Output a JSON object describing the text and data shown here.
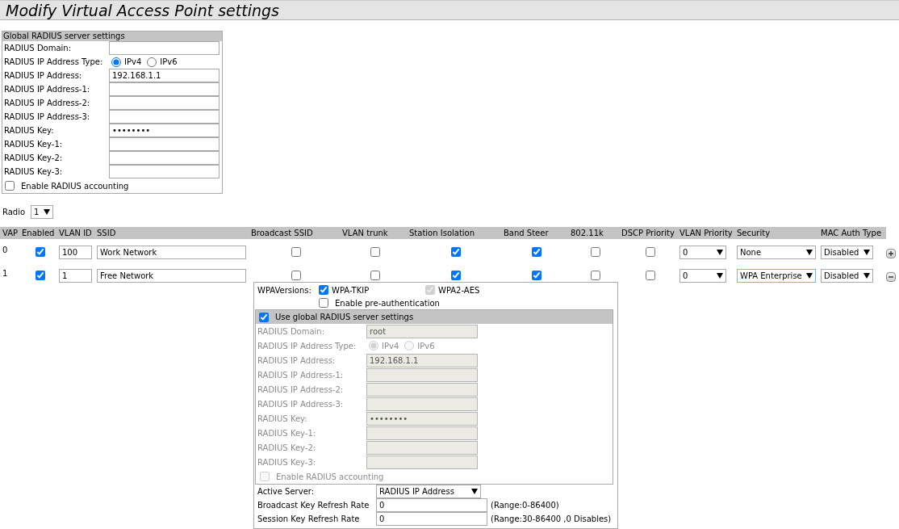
{
  "title": "Modify Virtual Access Point settings",
  "global_radius": {
    "header": "Global RADIUS server settings",
    "fields": [
      {
        "kind": "text",
        "label": "RADIUS Domain:"
      },
      {
        "kind": "radio",
        "label": "RADIUS IP Address Type:",
        "options": [
          {
            "label": "IPv4",
            "selected": true
          },
          {
            "label": "IPv6",
            "selected": false
          }
        ]
      },
      {
        "kind": "text",
        "label": "RADIUS IP Address:",
        "value": "192.168.1.1"
      },
      {
        "kind": "text",
        "label": "RADIUS IP Address-1:"
      },
      {
        "kind": "text",
        "label": "RADIUS IP Address-2:"
      },
      {
        "kind": "text",
        "label": "RADIUS IP Address-3:"
      },
      {
        "kind": "text",
        "label": "RADIUS Key:",
        "value": "••••••••"
      },
      {
        "kind": "text",
        "label": "RADIUS Key-1:"
      },
      {
        "kind": "text",
        "label": "RADIUS Key-2:"
      },
      {
        "kind": "text",
        "label": "RADIUS Key-3:"
      }
    ],
    "accounting": {
      "label": "Enable RADIUS accounting",
      "checked": false
    }
  },
  "radio": {
    "label": "Radio",
    "value": "1"
  },
  "vap_table": {
    "columns": [
      "VAP",
      "Enabled",
      "VLAN ID",
      "SSID",
      "Broadcast SSID",
      "VLAN trunk",
      "Station Isolation",
      "Band Steer",
      "802.11k",
      "DSCP Priority",
      "VLAN Priority",
      "Security",
      "MAC Auth Type"
    ],
    "rows": [
      {
        "vap": "0",
        "enabled": true,
        "vlan_id": "100",
        "ssid": "Work Network",
        "broadcast_ssid": false,
        "vlan_trunk": false,
        "station_isolation": true,
        "band_steer": true,
        "dot11k": false,
        "dscp_priority": false,
        "vlan_priority": "0",
        "security": {
          "value": "None",
          "focused": false
        },
        "mac_auth_type": "Disabled",
        "expanded": false
      },
      {
        "vap": "1",
        "enabled": true,
        "vlan_id": "1",
        "ssid": "Free Network",
        "broadcast_ssid": false,
        "vlan_trunk": false,
        "station_isolation": true,
        "band_steer": true,
        "dot11k": false,
        "dscp_priority": false,
        "vlan_priority": "0",
        "security": {
          "value": "WPA Enterprise",
          "focused": true
        },
        "mac_auth_type": "Disabled",
        "expanded": true,
        "wpa": {
          "versions_label": "WPAVersions:",
          "versions": [
            {
              "label": "WPA-TKIP",
              "checked": true,
              "disabled": false
            },
            {
              "label": "WPA2-AES",
              "checked": true,
              "disabled": true
            }
          ],
          "preauth": {
            "label": "Enable pre-authentication",
            "checked": false
          },
          "use_global": {
            "label": "Use global RADIUS server settings",
            "checked": true
          },
          "fields": [
            {
              "kind": "text",
              "label": "RADIUS Domain:",
              "value": "root"
            },
            {
              "kind": "radio",
              "label": "RADIUS IP Address Type:",
              "options": [
                {
                  "label": "IPv4",
                  "selected": true
                },
                {
                  "label": "IPv6",
                  "selected": false
                }
              ]
            },
            {
              "kind": "text",
              "label": "RADIUS IP Address:",
              "value": "192.168.1.1"
            },
            {
              "kind": "text",
              "label": "RADIUS IP Address-1:"
            },
            {
              "kind": "text",
              "label": "RADIUS IP Address-2:"
            },
            {
              "kind": "text",
              "label": "RADIUS IP Address-3:"
            },
            {
              "kind": "text",
              "label": "RADIUS Key:",
              "value": "••••••••"
            },
            {
              "kind": "text",
              "label": "RADIUS Key-1:"
            },
            {
              "kind": "text",
              "label": "RADIUS Key-2:"
            },
            {
              "kind": "text",
              "label": "RADIUS Key-3:"
            }
          ],
          "accounting": {
            "label": "Enable RADIUS accounting",
            "checked": false
          },
          "active_server": {
            "label": "Active Server:",
            "value": "RADIUS IP Address"
          },
          "refresh": [
            {
              "label": "Broadcast Key Refresh Rate",
              "value": "0",
              "hint": "(Range:0-86400)"
            },
            {
              "label": "Session Key Refresh Rate",
              "value": "0",
              "hint": "(Range:30-86400 ,0 Disables)"
            }
          ]
        }
      }
    ]
  }
}
